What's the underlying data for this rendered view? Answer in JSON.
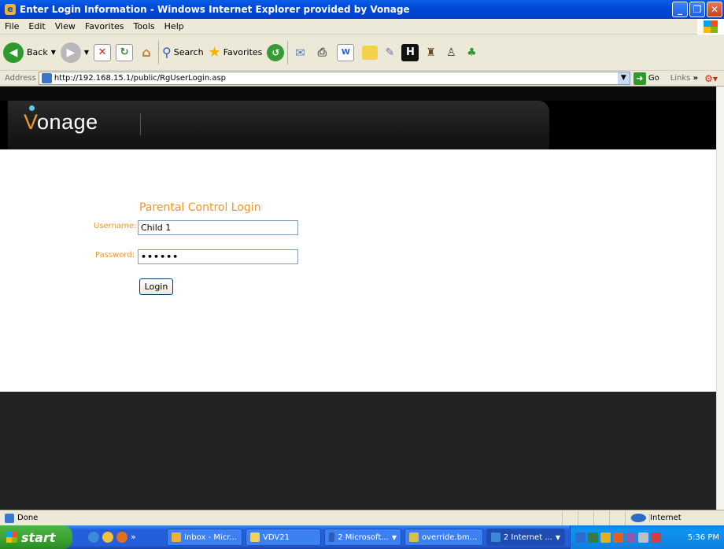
{
  "window": {
    "title": "Enter Login Information - Windows Internet Explorer provided by Vonage"
  },
  "menu": [
    "File",
    "Edit",
    "View",
    "Favorites",
    "Tools",
    "Help"
  ],
  "toolbar": {
    "back_label": "Back",
    "search_label": "Search",
    "favorites_label": "Favorites"
  },
  "address": {
    "label": "Address",
    "url": "http://192.168.15.1/public/RgUserLogin.asp",
    "go_label": "Go",
    "links_label": "Links"
  },
  "page": {
    "logo_text": "onage",
    "logo_initial": "V",
    "title": "Parental Control Login",
    "username_label": "Username:",
    "username_value": "Child 1",
    "password_label": "Password:",
    "password_value": "••••••",
    "login_button": "Login",
    "colors": {
      "accent": "#f0962e",
      "header_bg": "#000000",
      "footer_bg": "#232323"
    }
  },
  "status": {
    "text": "Done",
    "zone": "Internet"
  },
  "taskbar": {
    "start_label": "start",
    "tasks": [
      "Inbox - Micr...",
      "VDV21",
      "2 Microsoft...",
      "override.bm...",
      "2 Internet ..."
    ],
    "clock": "5:36 PM"
  }
}
